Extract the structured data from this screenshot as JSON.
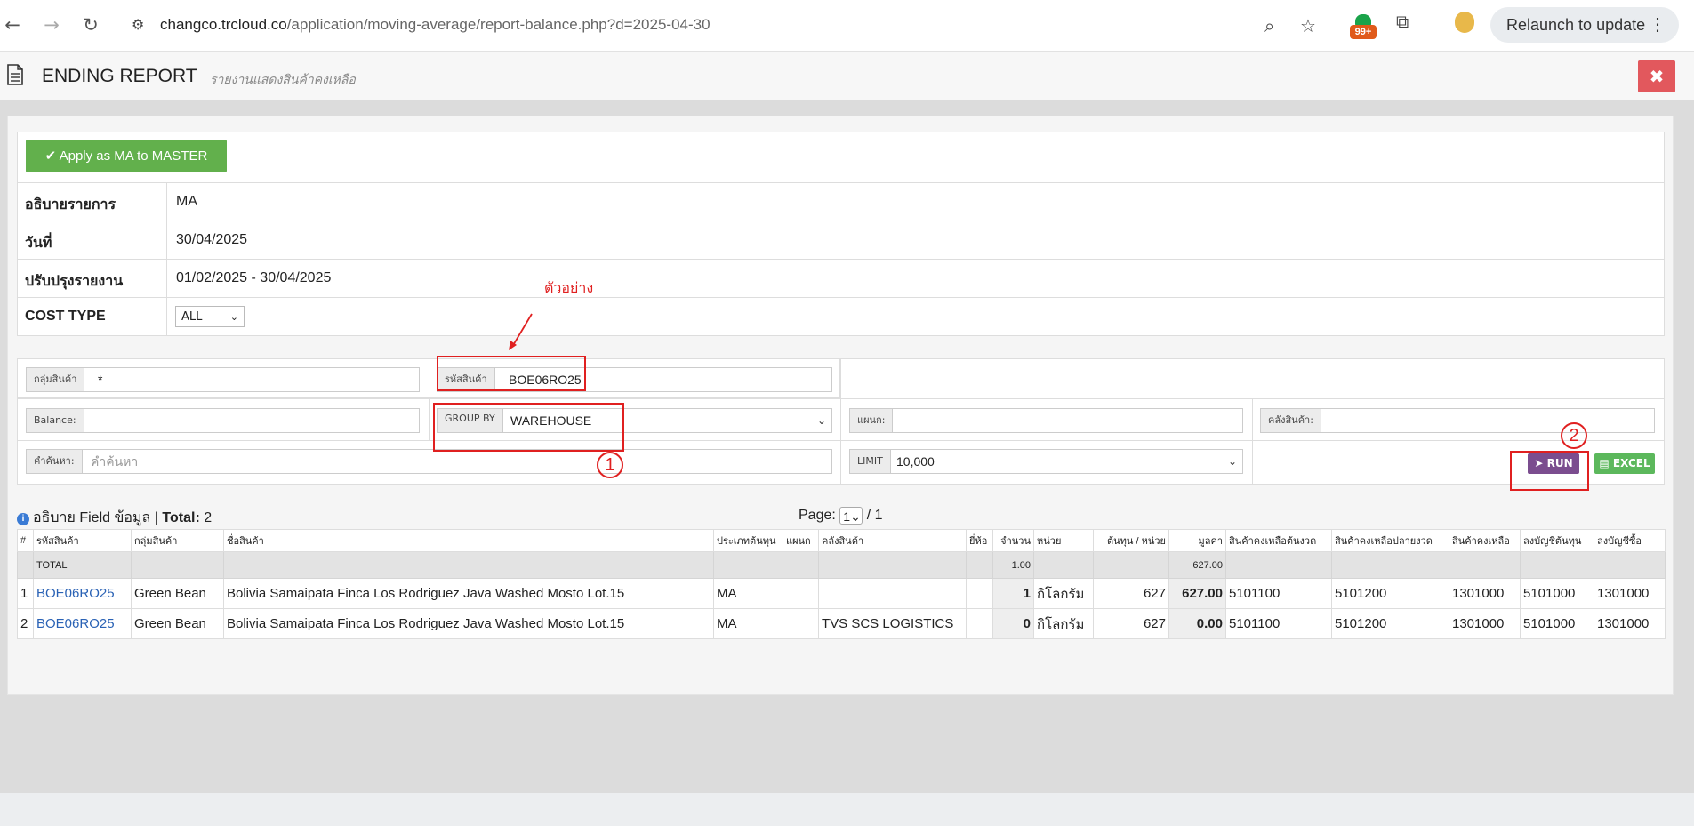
{
  "browser": {
    "url_domain": "changco.trcloud.co",
    "url_path": "/application/moving-average/report-balance.php?d=2025-04-30",
    "extension_badge": "99+",
    "relaunch_label": "Relaunch to update"
  },
  "header": {
    "title": "ENDING REPORT",
    "subtitle": "รายงานแสดงสินค้าคงเหลือ",
    "close_label": "✖"
  },
  "apply_button": "Apply as MA to MASTER",
  "info": {
    "rows": [
      {
        "label": "อธิบายรายการ",
        "value": "MA"
      },
      {
        "label": "วันที่",
        "value": "30/04/2025"
      },
      {
        "label": "ปรับปรุงรายงาน",
        "value": "01/02/2025 - 30/04/2025"
      },
      {
        "label": "COST TYPE",
        "value": "ALL"
      }
    ]
  },
  "filters": {
    "product_group": {
      "label": "กลุ่มสินค้า",
      "value": "*"
    },
    "product_code": {
      "label": "รหัสสินค้า",
      "value": "BOE06RO25"
    },
    "balance": {
      "label": "Balance:",
      "value": ""
    },
    "group_by": {
      "label": "GROUP BY",
      "value": "WAREHOUSE"
    },
    "department": {
      "label": "แผนก:",
      "value": ""
    },
    "warehouse": {
      "label": "คลังสินค้า:",
      "value": ""
    },
    "search": {
      "label": "คำค้นหา:",
      "placeholder": "คำค้นหา"
    },
    "limit": {
      "label": "LIMIT",
      "value": "10,000"
    }
  },
  "actions": {
    "run": "RUN",
    "excel": "EXCEL"
  },
  "annotations": {
    "example": "ตัวอย่าง",
    "step1": "1",
    "step2": "2"
  },
  "list": {
    "field_desc": "อธิบาย Field ข้อมูล",
    "total_label": "Total:",
    "total_value": "2",
    "page_label": "Page:",
    "page_current": "1",
    "page_total": "/ 1"
  },
  "table": {
    "columns": [
      "#",
      "รหัสสินค้า",
      "กลุ่มสินค้า",
      "ชื่อสินค้า",
      "ประเภทต้นทุน",
      "แผนก",
      "คลังสินค้า",
      "ยี่ห้อ",
      "จำนวน",
      "หน่วย",
      "ต้นทุน / หน่วย",
      "มูลค่า",
      "สินค้าคงเหลือต้นงวด",
      "สินค้าคงเหลือปลายงวด",
      "สินค้าคงเหลือ",
      "ลงบัญชีต้นทุน",
      "ลงบัญชีซื้อ"
    ],
    "total_row": {
      "label": "TOTAL",
      "qty": "1.00",
      "value": "627.00"
    },
    "rows": [
      {
        "no": "1",
        "code": "BOE06RO25",
        "group": "Green Bean",
        "name": "Bolivia Samaipata Finca Los Rodriguez Java Washed Mosto Lot.15",
        "cost_type": "MA",
        "dept": "",
        "warehouse": "",
        "brand": "",
        "qty": "1",
        "unit": "กิโลกรัม",
        "unit_cost": "627",
        "value": "627.00",
        "begin": "5101100",
        "end": "5101200",
        "stock": "1301000",
        "cost_acc": "5101000",
        "purchase_acc": "1301000"
      },
      {
        "no": "2",
        "code": "BOE06RO25",
        "group": "Green Bean",
        "name": "Bolivia Samaipata Finca Los Rodriguez Java Washed Mosto Lot.15",
        "cost_type": "MA",
        "dept": "",
        "warehouse": "TVS SCS LOGISTICS",
        "brand": "",
        "qty": "0",
        "unit": "กิโลกรัม",
        "unit_cost": "627",
        "value": "0.00",
        "begin": "5101100",
        "end": "5101200",
        "stock": "1301000",
        "cost_acc": "5101000",
        "purchase_acc": "1301000"
      }
    ]
  }
}
